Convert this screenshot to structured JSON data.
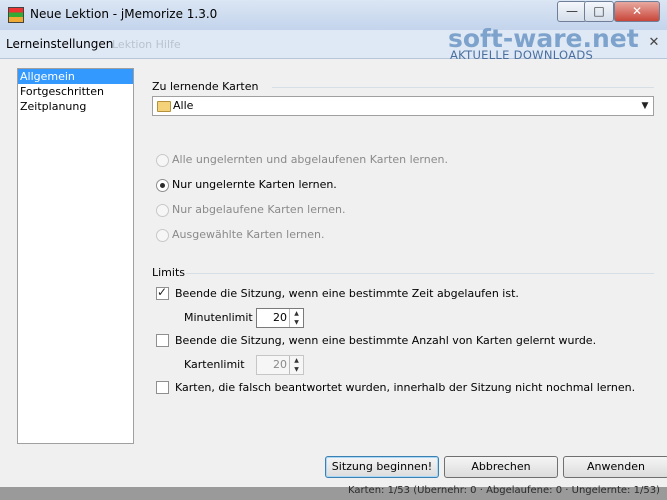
{
  "main_window": {
    "title": "Neue Lektion - jMemorize 1.3.0",
    "min_glyph": "—",
    "max_glyph": "□",
    "close_glyph": "✕"
  },
  "dialog": {
    "title": "Lerneinstellungen",
    "ghost_text": "Lektion Hilfe",
    "close_glyph": "✕",
    "watermark": {
      "main": "soft-ware.net",
      "sub": "AKTUELLE DOWNLOADS"
    }
  },
  "nav": {
    "items": [
      {
        "label": "Allgemein"
      },
      {
        "label": "Fortgeschritten"
      },
      {
        "label": "Zeitplanung"
      }
    ]
  },
  "cards_section": {
    "title": "Zu lernende Karten",
    "dropdown_value": "Alle",
    "dropdown_arrow": "▼",
    "options": [
      {
        "label": "Alle ungelernten und abgelaufenen Karten lernen."
      },
      {
        "label": "Nur ungelernte Karten lernen."
      },
      {
        "label": "Nur abgelaufene Karten lernen."
      },
      {
        "label": "Ausgewählte Karten lernen."
      }
    ]
  },
  "limits": {
    "title": "Limits",
    "time_limit_label": "Beende die Sitzung, wenn eine bestimmte Zeit abgelaufen ist.",
    "minutes_label": "Minutenlimit",
    "minutes_value": "20",
    "card_limit_label": "Beende die Sitzung, wenn eine bestimmte Anzahl von Karten gelernt wurde.",
    "cards_label": "Kartenlimit",
    "cards_value": "20",
    "wrong_label": "Karten, die falsch beantwortet wurden, innerhalb der Sitzung nicht nochmal lernen.",
    "spin_up": "▲",
    "spin_down": "▼"
  },
  "buttons": {
    "start": "Sitzung beginnen!",
    "cancel": "Abbrechen",
    "apply": "Anwenden"
  },
  "status_bar": {
    "text": "Karten: 1/53 (Ubernehr: 0 · Abgelaufene: 0 · Ungelernte: 1/53)"
  }
}
